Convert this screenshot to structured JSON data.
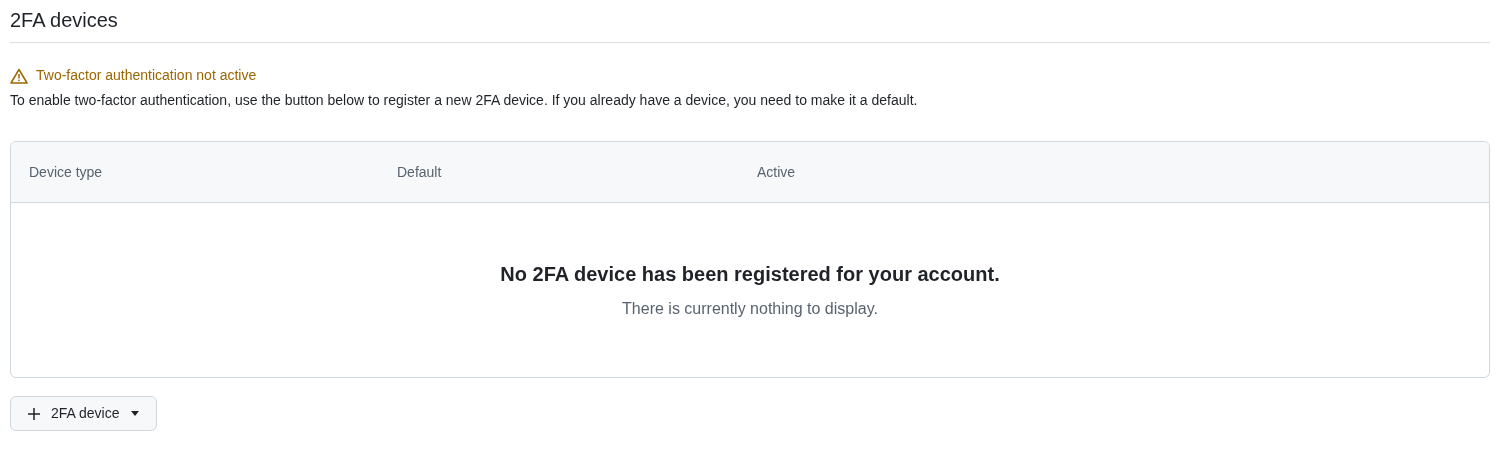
{
  "heading": "2FA devices",
  "warning": {
    "title": "Two-factor authentication not active",
    "text": "To enable two-factor authentication, use the button below to register a new 2FA device. If you already have a device, you need to make it a default."
  },
  "table": {
    "columns": [
      "Device type",
      "Default",
      "Active"
    ],
    "empty_state": {
      "title": "No 2FA device has been registered for your account.",
      "text": "There is currently nothing to display."
    }
  },
  "add_button": {
    "label": "2FA device"
  }
}
